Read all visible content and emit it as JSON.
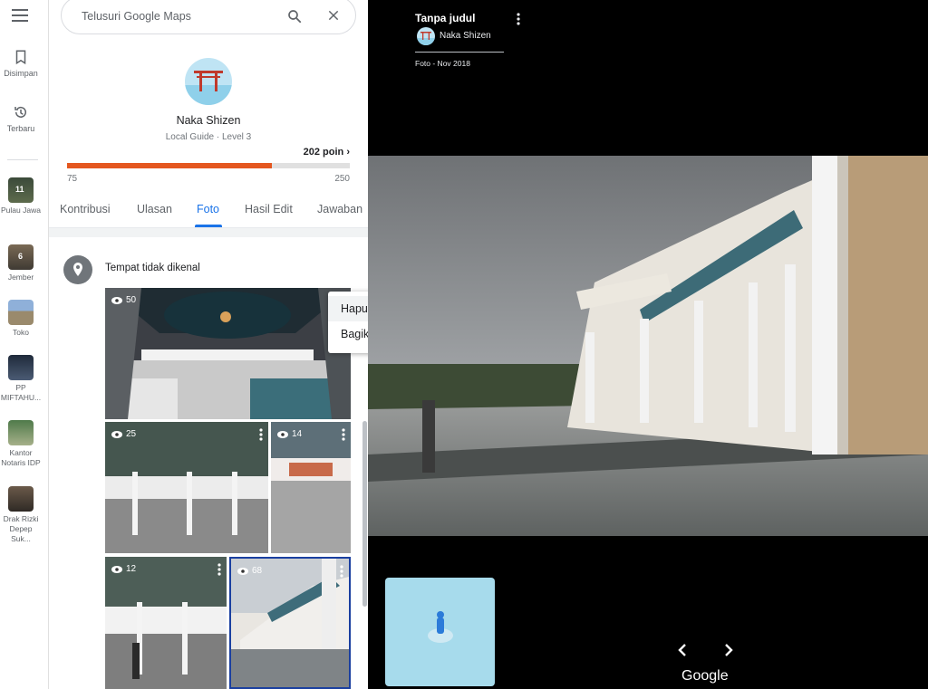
{
  "rail": {
    "saved_label": "Disimpan",
    "recent_label": "Terbaru",
    "recents": [
      {
        "label": "Pulau Jawa",
        "badge": "11"
      },
      {
        "label": "Jember",
        "badge": "6"
      },
      {
        "label": "Toko",
        "badge": ""
      },
      {
        "label": "PP MIFTAHU...",
        "badge": ""
      },
      {
        "label": "Kantor Notaris IDP",
        "badge": ""
      },
      {
        "label": "Drak Rizki Depep Suk...",
        "badge": ""
      }
    ]
  },
  "search": {
    "placeholder": "Telusuri Google Maps",
    "icon": "search-icon",
    "close_icon": "close-icon"
  },
  "profile": {
    "name": "Naka Shizen",
    "level": "Local Guide · Level 3",
    "points": "202 poin",
    "progress_min": "75",
    "progress_max": "250",
    "progress_value": 202,
    "progress_color": "#e4571f"
  },
  "tabs": [
    "Kontribusi",
    "Ulasan",
    "Foto",
    "Hasil Edit",
    "Jawaban"
  ],
  "active_tab": "Foto",
  "section": {
    "place": "Tempat tidak dikenal"
  },
  "photos": [
    {
      "views": "50"
    },
    {
      "views": "25"
    },
    {
      "views": "14"
    },
    {
      "views": "12"
    },
    {
      "views": "68"
    }
  ],
  "context_menu": {
    "items": [
      "Hapus foto ini",
      "Bagikan"
    ]
  },
  "viewer": {
    "title": "Tanpa judul",
    "author": "Naka Shizen",
    "date": "Foto - Nov 2018",
    "brand": "Google"
  }
}
